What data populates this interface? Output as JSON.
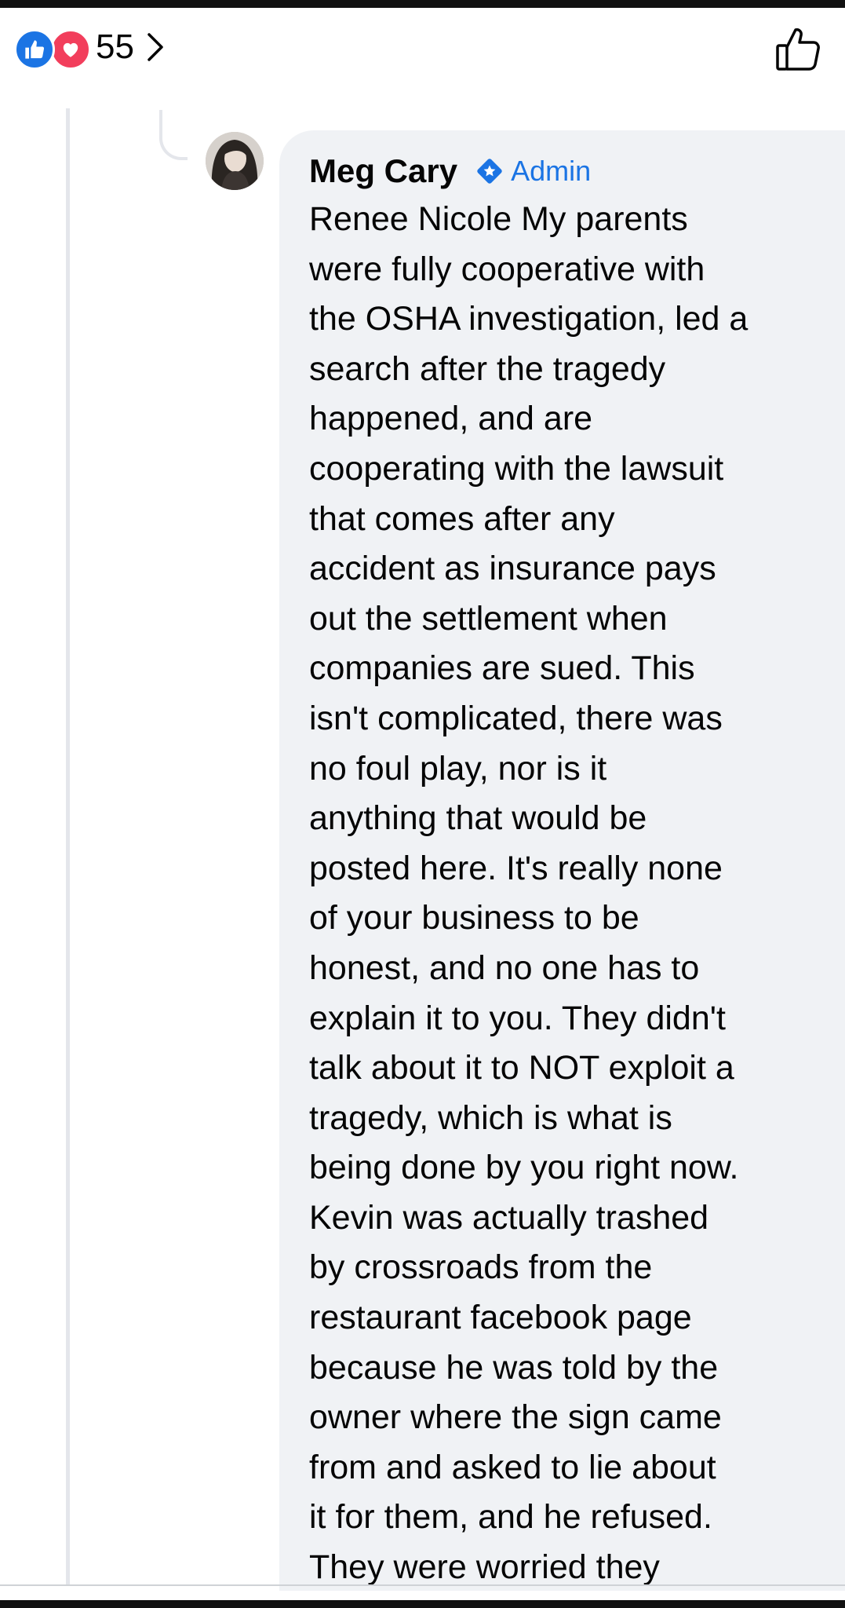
{
  "reactions": {
    "icons": [
      "like-icon",
      "love-icon"
    ],
    "count": "55",
    "colors": {
      "like": "#1b74e4",
      "love": "#f23e5c"
    }
  },
  "comment": {
    "author": "Meg Cary",
    "badge": "Admin",
    "text": "Renee Nicole My parents\nwere fully cooperative with\nthe OSHA investigation, led a\nsearch after the tragedy\nhappened,  and are\ncooperating with the lawsuit\nthat comes after any\naccident as insurance pays\nout the settlement when\ncompanies are sued. This\nisn't complicated, there was\nno foul play, nor is it\nanything that would be\nposted here. It's really none\nof your business to be\nhonest, and no one has to\nexplain it to you. They didn't\ntalk about it to NOT exploit a\ntragedy, which is what is\nbeing done by you right now.\nKevin was actually trashed\nby crossroads from the\nrestaurant facebook page\nbecause he was told by the\nowner where the sign came\nfrom and asked to lie about\nit for them, and he refused.\nThey were worried they"
  },
  "colors": {
    "bubble_bg": "#f0f2f5",
    "accent": "#1b74e4",
    "text": "#050505"
  }
}
